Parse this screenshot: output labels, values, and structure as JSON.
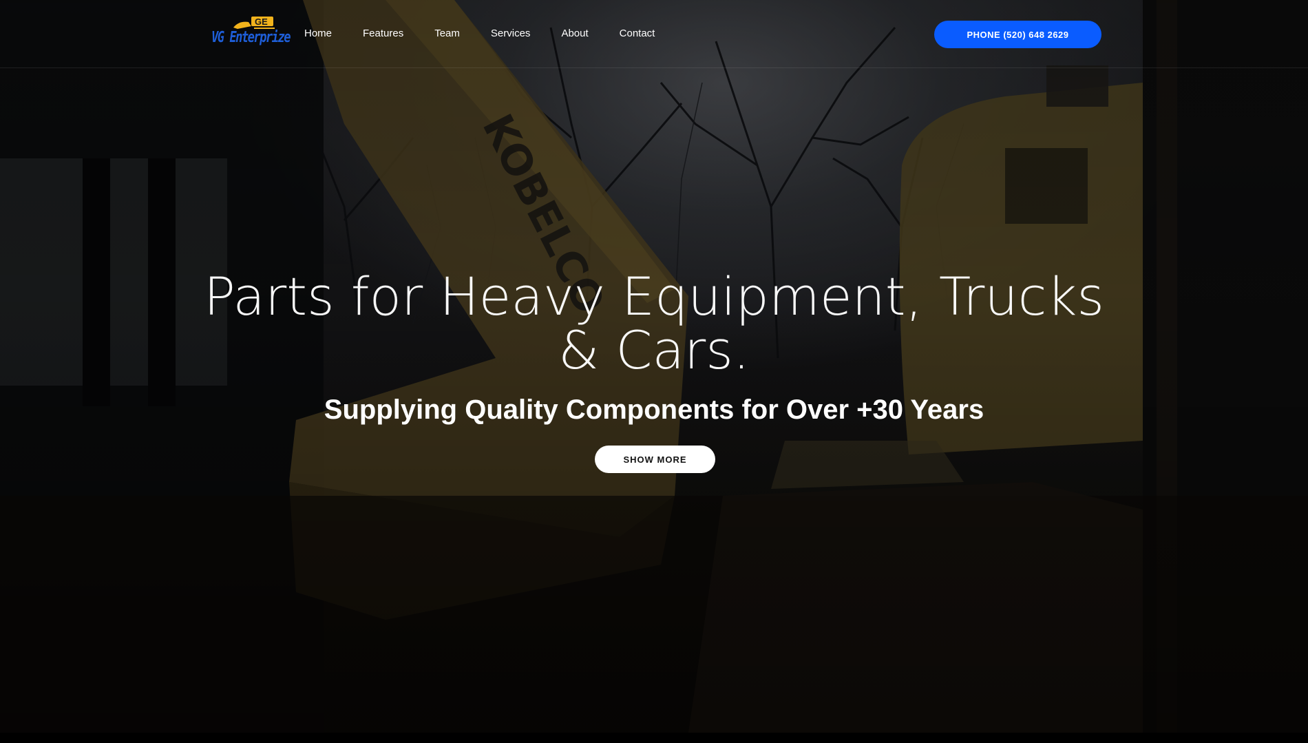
{
  "brand": {
    "logo_text": "VG Enterprize",
    "logo_badge_text": "GE"
  },
  "nav": {
    "items": [
      {
        "label": "Home"
      },
      {
        "label": "Features"
      },
      {
        "label": "Team"
      },
      {
        "label": "Services"
      },
      {
        "label": "About"
      },
      {
        "label": "Contact"
      }
    ]
  },
  "header": {
    "phone_button_label": "PHONE (520) 648 2629"
  },
  "hero": {
    "title_line1": "Parts for Heavy Equipment, Trucks",
    "title_line2": "& Cars.",
    "subtitle": "Supplying Quality Components for Over +30 Years",
    "cta_label": "SHOW MORE",
    "background_description_text": "KOBELCO"
  },
  "colors": {
    "accent_blue": "#0a5cff",
    "logo_blue": "#1e5ed8",
    "logo_gold": "#f2b31c",
    "cta_bg": "#ffffff"
  },
  "icons": {
    "logo": "excavator-logo-icon"
  }
}
